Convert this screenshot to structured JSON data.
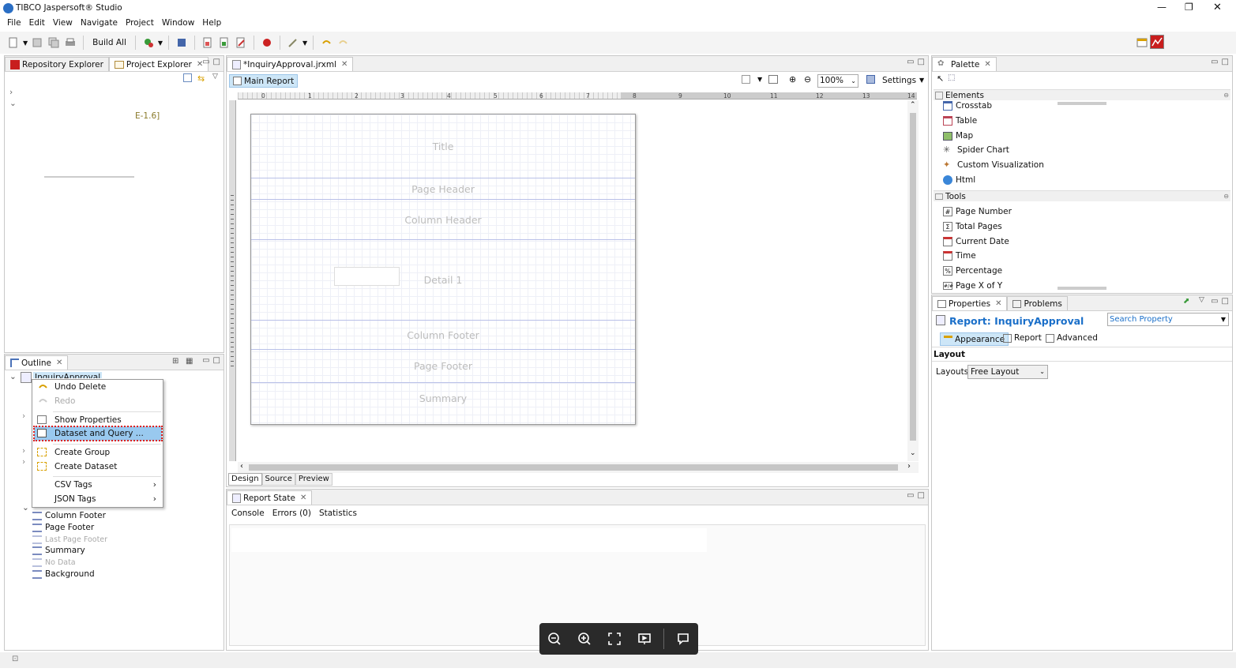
{
  "window": {
    "title": "TIBCO Jaspersoft® Studio",
    "controls": [
      "—",
      "❐",
      "✕"
    ]
  },
  "menu": [
    "File",
    "Edit",
    "View",
    "Navigate",
    "Project",
    "Window",
    "Help"
  ],
  "toolbar": {
    "build_all": "Build All"
  },
  "left_top": {
    "tabs": [
      "Repository Explorer",
      "Project Explorer"
    ],
    "tree_fragment": "E-1.6]"
  },
  "outline": {
    "tab": "Outline",
    "root": "InquiryApproval",
    "items": [
      "Column Footer",
      "Page Footer",
      "Last Page Footer",
      "Summary",
      "No Data",
      "Background"
    ]
  },
  "context_menu": {
    "items": [
      "Undo Delete",
      "Redo",
      "Show Properties",
      "Dataset and Query ...",
      "Create Group",
      "Create Dataset",
      "CSV Tags",
      "JSON Tags"
    ]
  },
  "editor": {
    "tab": "*InquiryApproval.jrxml",
    "main_report": "Main Report",
    "zoom": "100%",
    "settings": "Settings",
    "bands": [
      "Title",
      "Page Header",
      "Column Header",
      "Detail 1",
      "Column Footer",
      "Page Footer",
      "Summary"
    ],
    "ruler_numbers": [
      "0",
      "1",
      "2",
      "3",
      "4",
      "5",
      "6",
      "7",
      "8",
      "9",
      "10",
      "11",
      "12",
      "13",
      "14"
    ],
    "bottom_tabs": [
      "Design",
      "Source",
      "Preview"
    ]
  },
  "report_state": {
    "tab": "Report State",
    "tabs": [
      "Console",
      "Errors (0)",
      "Statistics"
    ]
  },
  "palette": {
    "tab": "Palette",
    "elements_header": "Elements",
    "elements": [
      "Crosstab",
      "Table",
      "Map",
      "Spider Chart",
      "Custom Visualization",
      "Html"
    ],
    "tools_header": "Tools",
    "tools": [
      "Page Number",
      "Total Pages",
      "Current Date",
      "Time",
      "Percentage",
      "Page X of Y"
    ]
  },
  "properties": {
    "tabs": [
      "Properties",
      "Problems"
    ],
    "title": "Report: InquiryApproval",
    "search_placeholder": "Search Property",
    "subtabs": [
      "Appearance",
      "Report",
      "Advanced"
    ],
    "section": "Layout",
    "layouts_label": "Layouts",
    "layouts_value": "Free Layout"
  },
  "colors": {
    "accent": "#1a6fc9",
    "selection": "#cde6f7",
    "menu_highlight": "#99c9ef",
    "red_dotted": "#e0201c"
  }
}
